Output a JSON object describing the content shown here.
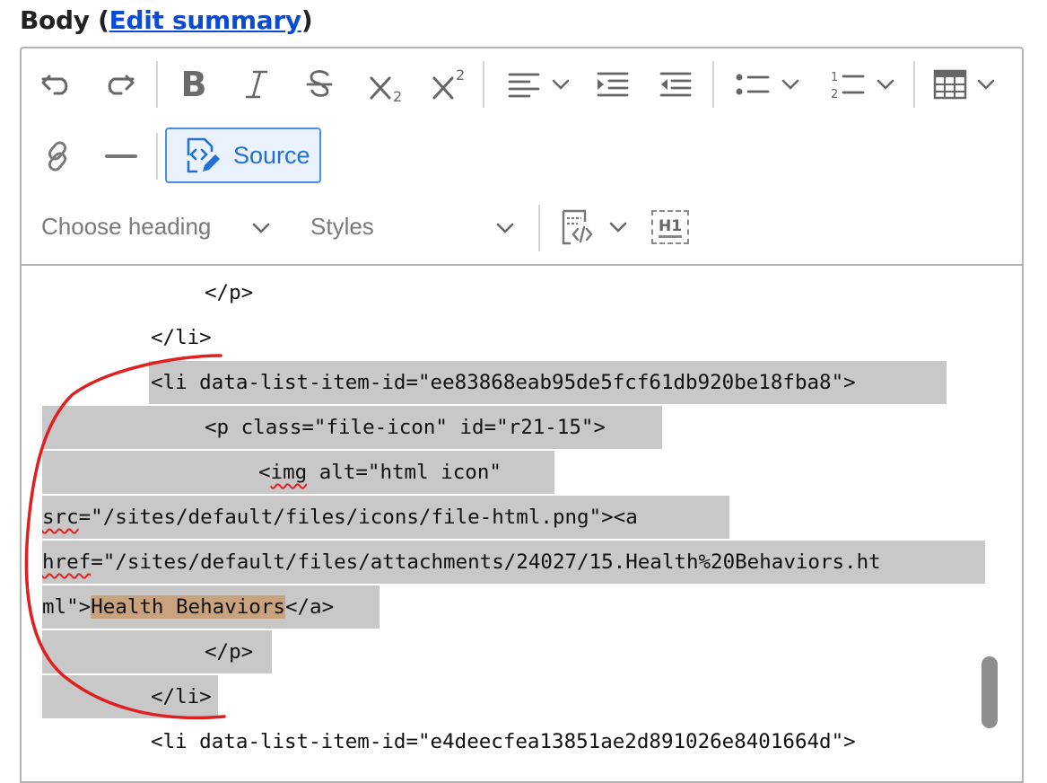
{
  "field": {
    "label_prefix": "Body (",
    "link_text": "Edit summary",
    "label_suffix": ")"
  },
  "toolbar": {
    "source_label": "Source",
    "heading_dropdown": "Choose heading",
    "styles_dropdown": "Styles",
    "heading_badge": "H1"
  },
  "code": {
    "lines": [
      "</p>",
      "</li>",
      "<li data-list-item-id=\"ee83868eab95de5fcf61db920be18fba8\">",
      "<p class=\"file-icon\" id=\"r21-15\">",
      "alt=\"html icon\"",
      "=\"/sites/default/files/icons/file-html.png\"><a",
      "=\"/sites/default/files/attachments/24027/15.Health%20Behaviors.ht",
      "ml\">",
      "Health Behaviors",
      "</a>",
      "</p>",
      "</li>",
      "<li data-list-item-id=\"e4deecfea13851ae2d891026e8401664d\">"
    ],
    "img_tag_open": "<",
    "img_word": "img",
    "src_word": "src",
    "href_word": "href"
  },
  "colors": {
    "accent": "#2170d6",
    "selection": "#c8c8c8",
    "text_selection": "#c8a37d",
    "annotation": "#e02020"
  }
}
